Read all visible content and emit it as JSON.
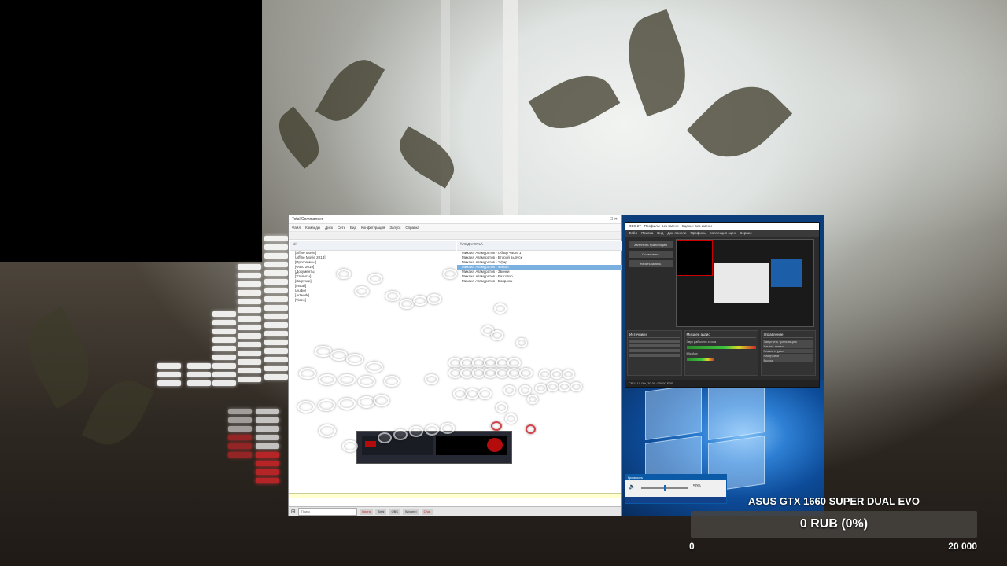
{
  "left_window": {
    "title": "Total Commander",
    "menu": [
      "Файл",
      "Команды",
      "Диск",
      "Сеть",
      "Вид",
      "Конфигурация",
      "Запуск",
      "Справка"
    ],
    "panel_left_path": "d:\\",
    "panel_right_path": "\\\\ПОДКАСТЫ\\",
    "left_files": [
      "[Affine Movie]",
      "[Affine Movie 2014]",
      "[Программы]",
      "[Фото 2019]",
      "[Документы]",
      "[Утилиты]",
      "[Загрузки]",
      "[Install]",
      "[Audio]",
      "[Artwork]",
      "[Video]"
    ],
    "right_files": [
      "Михаил Атамуратов - Обзор часть 1",
      "Михаил Атамуратов - Второй выпуск",
      "Михаил Атамуратов - Эфир",
      "Михаил Атамуратов - Финал",
      "Михаил Атамуратов - Звонки",
      "Михаил Атамуратов - Разговор",
      "Михаил Атамуратов - Вопросы"
    ],
    "selected_right_index": 3,
    "taskbar_search": "Поиск"
  },
  "obs": {
    "title": "OBS 27 - Профиль: Без имени - Сцены: Без имени",
    "menu": [
      "Файл",
      "Правка",
      "Вид",
      "Док-панели",
      "Профиль",
      "Коллекция сцен",
      "Сервис",
      "Справка"
    ],
    "side_buttons": [
      "Запустить трансляцию",
      "Остановить",
      "Начать запись",
      "Режим студии",
      "Настройки",
      "Выход"
    ],
    "docks": [
      "Источники",
      "Микшер аудио",
      "Управление"
    ],
    "mixer_channels": [
      "Звук рабочего стола",
      "Mic/Aux"
    ],
    "status": "CPU: 10.0%, 30.00 / 30.00 FPS"
  },
  "volume_popup": {
    "title": "Громкость",
    "percent": 50
  },
  "goal": {
    "title": "ASUS GTX 1660 SUPER DUAL EVO",
    "amount_text": "0 RUB (0%)",
    "progress_fraction": 0.0,
    "min_label": "0",
    "max_label": "20 000",
    "fill_color": "#3fb04a"
  }
}
